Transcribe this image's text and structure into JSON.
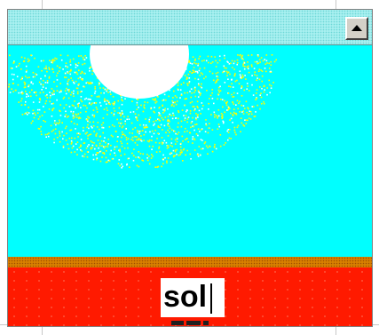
{
  "window": {
    "colors": {
      "sky": "#00ffff",
      "sun_core": "#ffffff",
      "sun_glow": "#ffff00",
      "horizon": "#d88000",
      "ground": "#ff1a00"
    }
  },
  "scrollbar": {
    "up_icon": "arrow-up-icon"
  },
  "scene": {
    "text_input": {
      "value": "sol"
    }
  }
}
